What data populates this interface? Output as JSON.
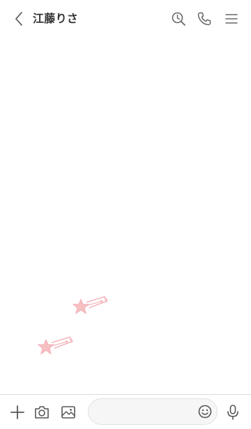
{
  "header": {
    "title": "江藤りさ",
    "icons": {
      "back": "chevron-left-icon",
      "search": "search-history-icon",
      "call": "phone-icon",
      "menu": "hamburger-menu-icon"
    }
  },
  "chat": {
    "decorations": [
      "shooting-star",
      "shooting-star"
    ],
    "accent_color": "#f7c1c4"
  },
  "footer": {
    "input_value": "",
    "input_placeholder": "",
    "icons": {
      "plus": "plus-icon",
      "camera": "camera-icon",
      "image": "image-icon",
      "emoji": "emoji-icon",
      "mic": "microphone-icon"
    }
  },
  "colors": {
    "icon": "#555555",
    "title": "#333333",
    "divider": "#d9d9d9",
    "input_bg": "#f6f6f6"
  }
}
